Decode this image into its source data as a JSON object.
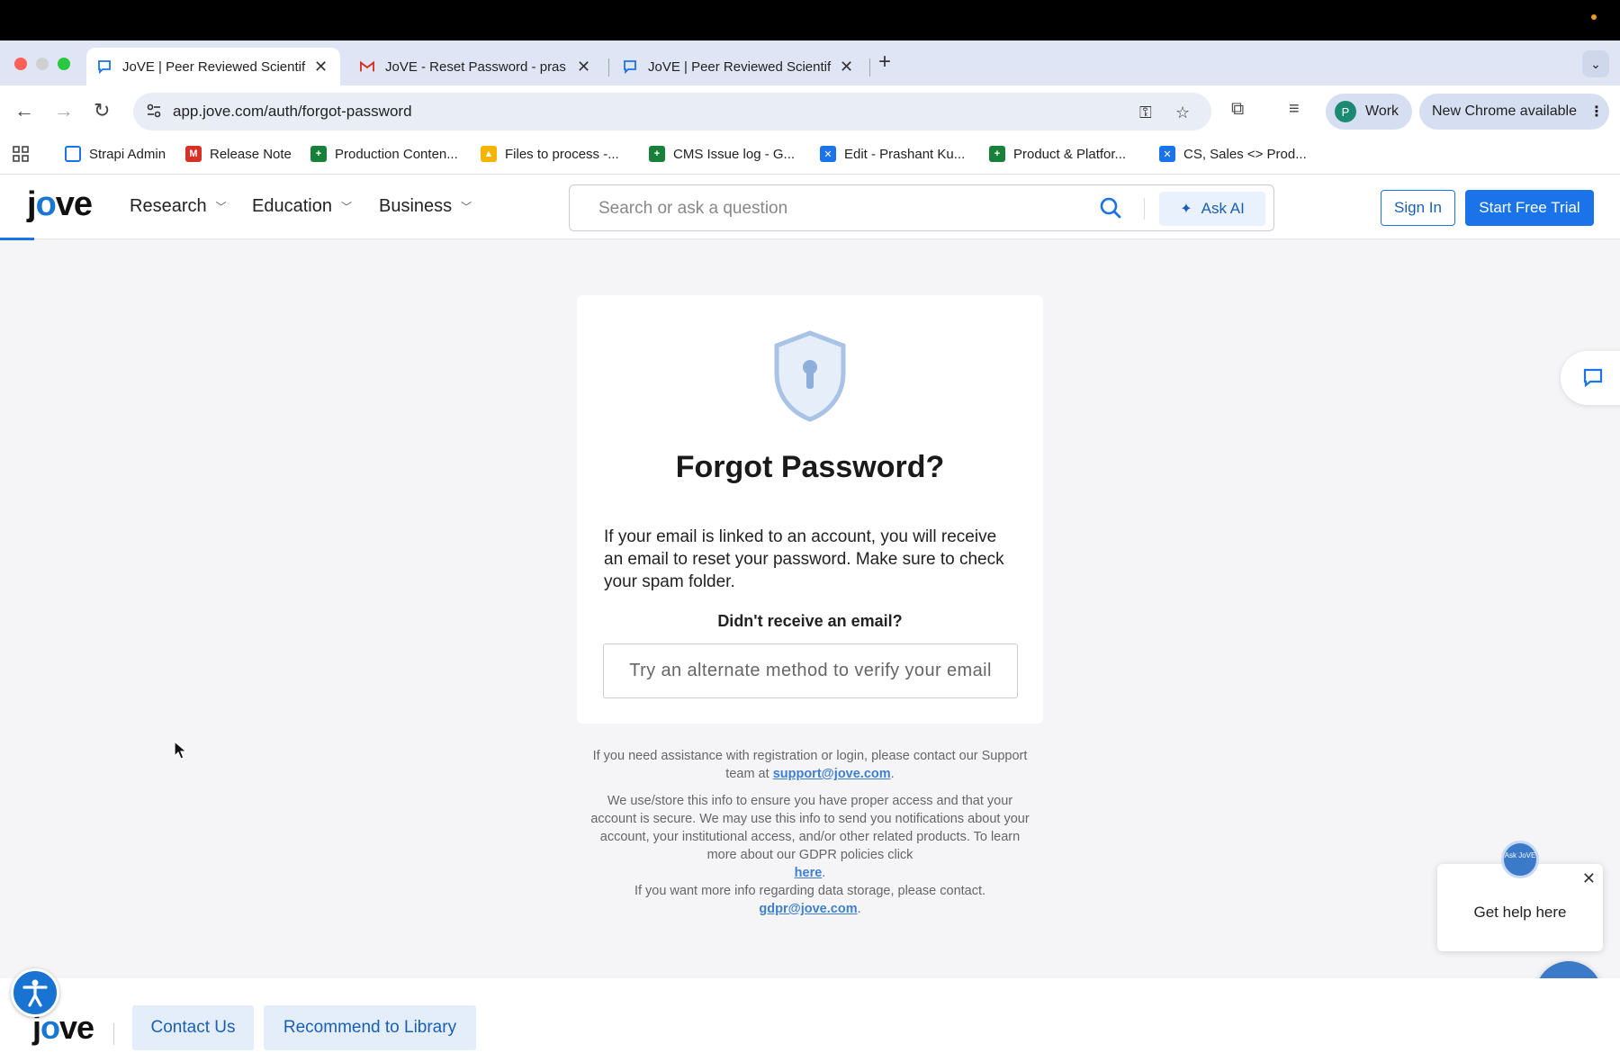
{
  "browser": {
    "tabs": [
      {
        "title": "JoVE | Peer Reviewed Scientif",
        "icon": "jove-chat-icon",
        "active": true
      },
      {
        "title": "JoVE - Reset Password - pras",
        "icon": "gmail-icon",
        "active": false
      },
      {
        "title": "JoVE | Peer Reviewed Scientif",
        "icon": "jove-chat-icon",
        "active": false
      }
    ],
    "url": "app.jove.com/auth/forgot-password",
    "profile_initial": "P",
    "profile_label": "Work",
    "update_label": "New Chrome available",
    "bookmarks": [
      {
        "label": "Strapi Admin",
        "color": "#1a73e8"
      },
      {
        "label": "Release Note",
        "color": "#d93025"
      },
      {
        "label": "Production Conten...",
        "color": "#188038"
      },
      {
        "label": "Files to process -...",
        "color": "#f4b400"
      },
      {
        "label": "CMS Issue log - G...",
        "color": "#188038"
      },
      {
        "label": "Edit - Prashant Ku...",
        "color": "#1a73e8"
      },
      {
        "label": "Product & Platfor...",
        "color": "#188038"
      },
      {
        "label": "CS, Sales <> Prod...",
        "color": "#1a73e8"
      }
    ]
  },
  "header": {
    "logo": "jove",
    "nav": [
      "Research",
      "Education",
      "Business"
    ],
    "search_placeholder": "Search or ask a question",
    "ask_ai": "Ask AI",
    "sign_in": "Sign In",
    "trial": "Start Free Trial"
  },
  "card": {
    "title": "Forgot Password?",
    "description": "If your email is linked to an account, you will receive an email to reset your password. Make sure to check your spam folder.",
    "didnt_receive": "Didn't receive an email?",
    "alt_method": "Try an alternate method to verify your email"
  },
  "notes": {
    "support_pre": "If you need assistance with registration or login, please contact our Support team at",
    "support_email": "support@jove.com",
    "gdpr_text": "We use/store this info to ensure you have proper access and that your account is secure. We may use this info to send you notifications about your account, your institutional access, and/or other related products. To learn more about our GDPR policies click",
    "here": "here",
    "storage_text": "If you want more info regarding data storage, please contact.",
    "gdpr_email": "gdpr@jove.com"
  },
  "help": {
    "popup_text": "Get help here",
    "bubble_text": "Ask JoVE"
  },
  "footer": {
    "logo": "jove",
    "contact": "Contact Us",
    "recommend": "Recommend to Library"
  },
  "colors": {
    "accent": "#1a73e8",
    "tabstrip": "#dfe5f4"
  }
}
